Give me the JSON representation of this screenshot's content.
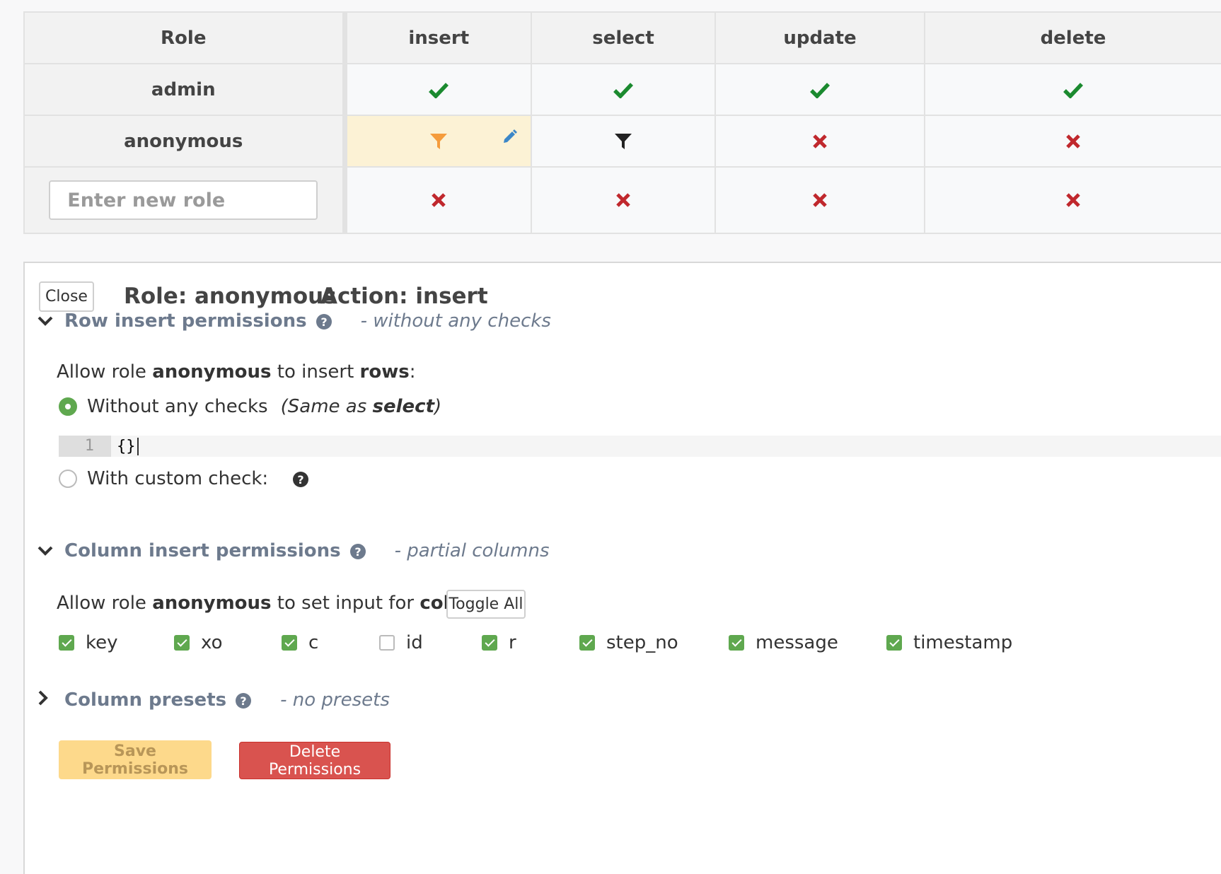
{
  "table": {
    "headers": [
      "Role",
      "insert",
      "select",
      "update",
      "delete"
    ],
    "rows": [
      {
        "role": "admin",
        "cells": [
          "check-icon",
          "check-icon",
          "check-icon",
          "check-icon"
        ]
      },
      {
        "role": "anonymous",
        "cells": [
          "filter-icon-orange",
          "filter-icon",
          "cross-icon",
          "cross-icon"
        ]
      }
    ],
    "new_role": {
      "placeholder": "Enter new role",
      "value": "",
      "cells": [
        "cross-icon",
        "cross-icon",
        "cross-icon",
        "cross-icon"
      ]
    }
  },
  "panel": {
    "close_label": "Close",
    "role_header": "Role: anonymous",
    "action_header": "Action: insert",
    "row_section": {
      "title": "Row insert permissions",
      "summary": "- without any checks",
      "expanded": true,
      "allow_prefix": "Allow role ",
      "allow_role": "anonymous",
      "allow_middle": " to insert ",
      "allow_target": "rows",
      "allow_suffix": ":",
      "option_without": "Without any checks",
      "option_note_prefix": "(Same as ",
      "option_note_bold": "select",
      "option_note_suffix": ")",
      "option_without_checked": true,
      "code_line_number": "1",
      "code_text": "{}",
      "option_custom": "With custom check:",
      "option_custom_checked": false
    },
    "column_section": {
      "title": "Column insert permissions",
      "summary": "- partial columns",
      "expanded": true,
      "allow_prefix": "Allow role ",
      "allow_role": "anonymous",
      "allow_middle": " to set input for ",
      "allow_target": "columns",
      "allow_suffix": ":",
      "toggle_all_label": "Toggle All",
      "columns": [
        {
          "name": "key",
          "checked": true
        },
        {
          "name": "xo",
          "checked": true
        },
        {
          "name": "c",
          "checked": true
        },
        {
          "name": "id",
          "checked": false
        },
        {
          "name": "r",
          "checked": true
        },
        {
          "name": "step_no",
          "checked": true
        },
        {
          "name": "message",
          "checked": true
        },
        {
          "name": "timestamp",
          "checked": true
        }
      ]
    },
    "presets_section": {
      "title": "Column presets",
      "summary": "- no presets",
      "expanded": false
    },
    "save_label": "Save Permissions",
    "delete_label": "Delete Permissions"
  },
  "colors": {
    "check": "#1b8a2f",
    "cross": "#c0282d",
    "filter_active": "#f59c3c",
    "filter": "#222222",
    "pencil": "#3c87c8",
    "section_title": "#6d7a8d",
    "active_cell": "#fcf2d5",
    "save": "#fdd98b",
    "delete": "#d9534f",
    "radio_checked": "#5fa84f"
  }
}
